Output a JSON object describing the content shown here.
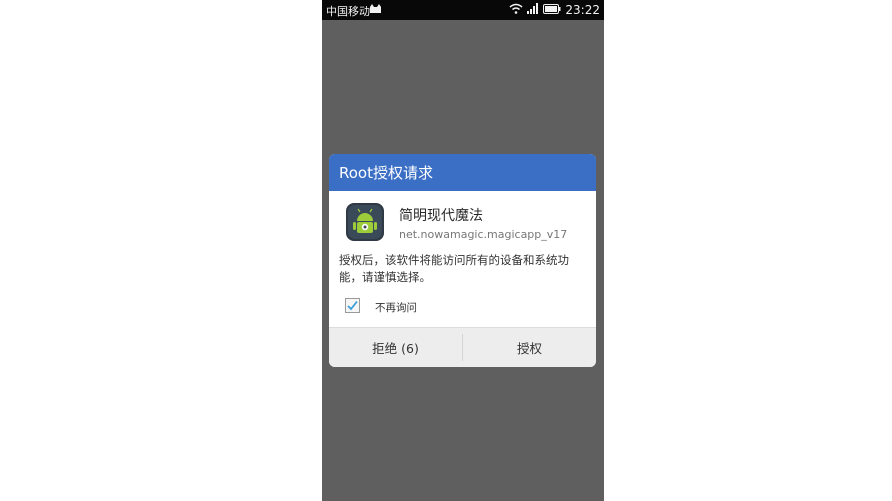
{
  "status_bar": {
    "carrier": "中国移动",
    "time": "23:22",
    "icons": [
      "cat-icon",
      "wifi-icon",
      "signal-icon",
      "battery-icon"
    ]
  },
  "dialog": {
    "title": "Root授权请求",
    "app": {
      "name": "简明现代魔法",
      "package": "net.nowamagic.magicapp_v17",
      "icon": "android-app-icon"
    },
    "message": "授权后，该软件将能访问所有的设备和系统功能，请谨慎选择。",
    "checkbox": {
      "label": "不再询问",
      "checked": true
    },
    "buttons": {
      "deny": "拒绝 (6)",
      "grant": "授权"
    }
  },
  "colors": {
    "header": "#3b6fc5",
    "overlay": "#5f5f5f",
    "check": "#3a9fd8"
  }
}
